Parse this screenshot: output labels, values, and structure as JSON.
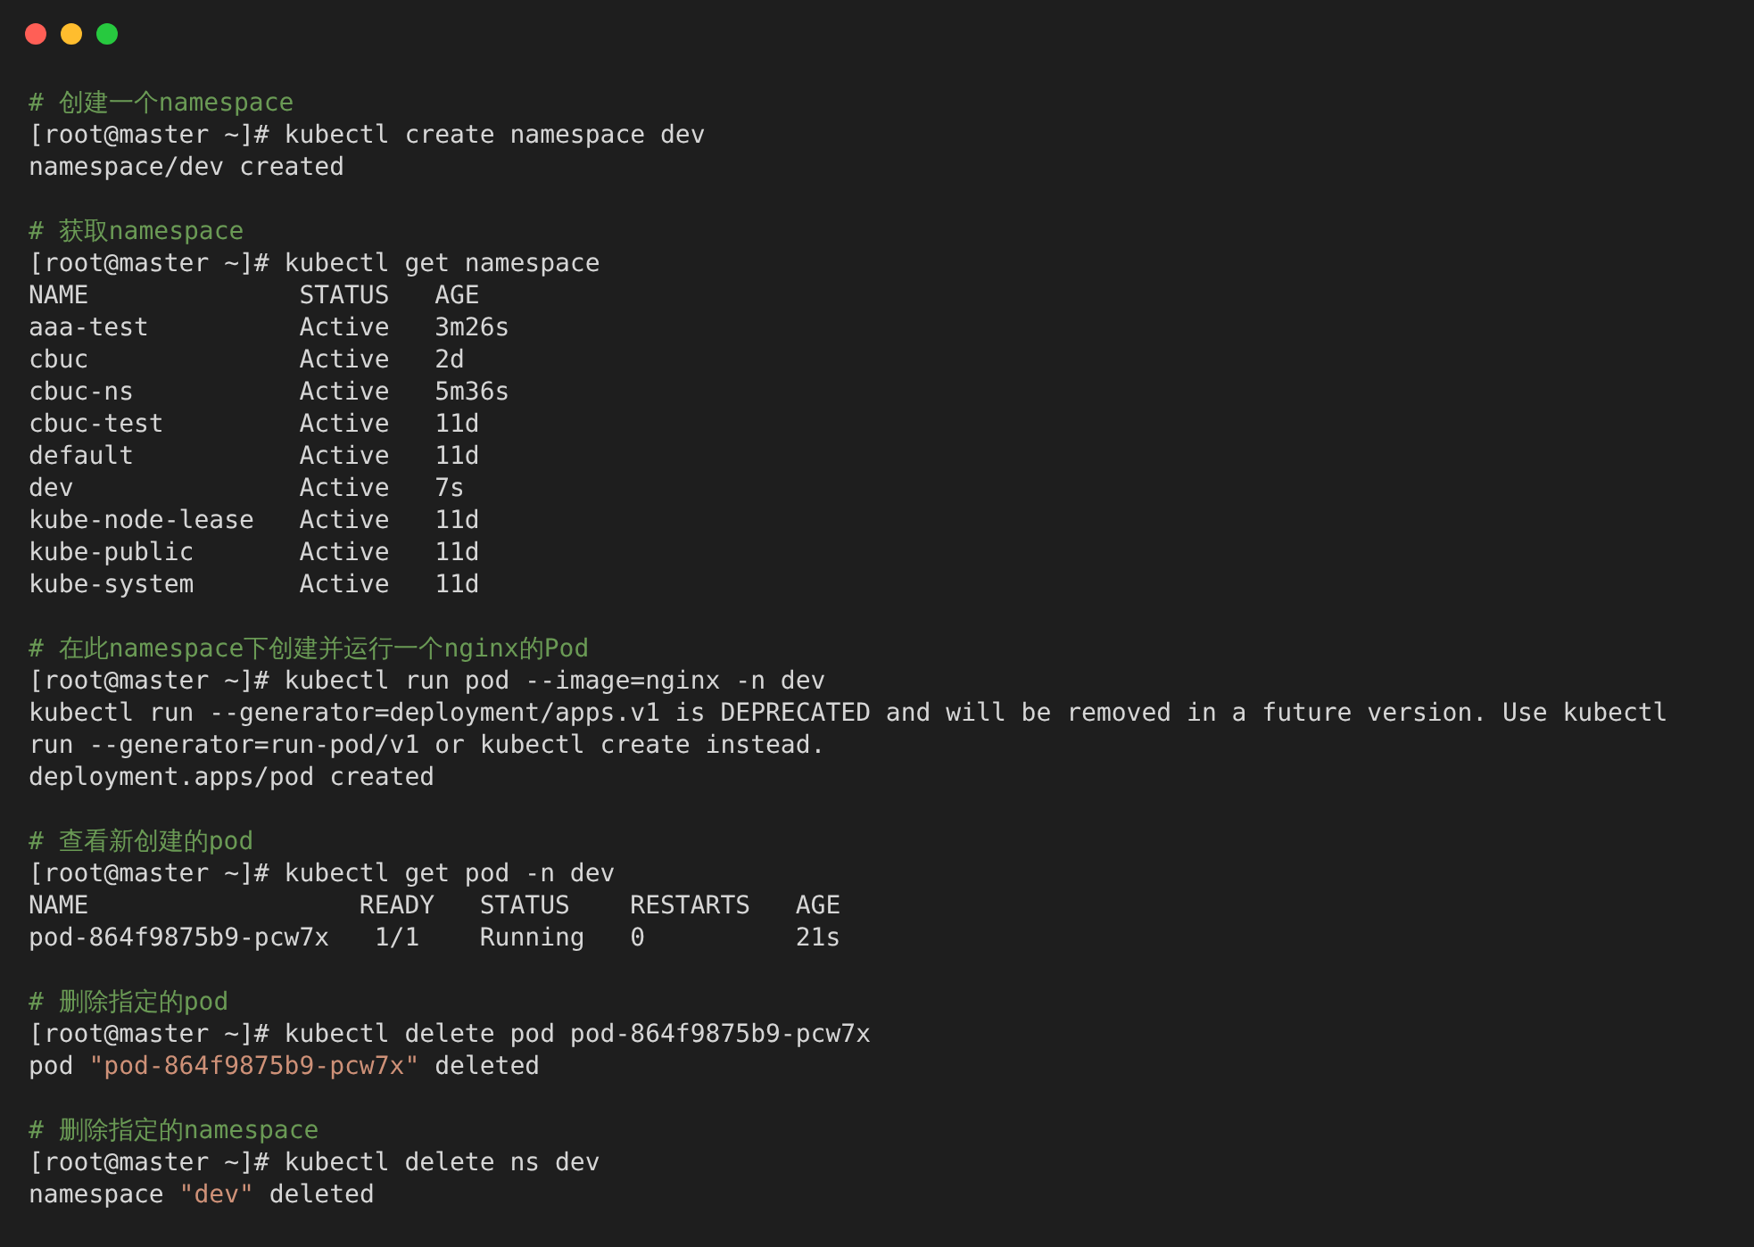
{
  "window": {
    "controls": [
      {
        "color": "#ff5f56"
      },
      {
        "color": "#ffbd2e"
      },
      {
        "color": "#27c93f"
      }
    ]
  },
  "blocks": [
    {
      "lines": [
        {
          "kind": "comment",
          "parts": [
            {
              "kind": "plain",
              "text": "# 创建一个namespace"
            }
          ]
        },
        {
          "kind": "command",
          "parts": [
            {
              "kind": "plain",
              "text": "[root@master ~]# kubectl create namespace dev"
            }
          ]
        },
        {
          "kind": "output",
          "parts": [
            {
              "kind": "plain",
              "text": "namespace/dev created"
            }
          ]
        }
      ]
    },
    {
      "lines": [
        {
          "kind": "comment",
          "parts": [
            {
              "kind": "plain",
              "text": "# 获取namespace"
            }
          ]
        },
        {
          "kind": "command",
          "parts": [
            {
              "kind": "plain",
              "text": "[root@master ~]# kubectl get namespace"
            }
          ]
        },
        {
          "kind": "output",
          "parts": [
            {
              "kind": "plain",
              "text": "NAME              STATUS   AGE"
            }
          ]
        },
        {
          "kind": "output",
          "parts": [
            {
              "kind": "plain",
              "text": "aaa-test          Active   3m26s"
            }
          ]
        },
        {
          "kind": "output",
          "parts": [
            {
              "kind": "plain",
              "text": "cbuc              Active   2d"
            }
          ]
        },
        {
          "kind": "output",
          "parts": [
            {
              "kind": "plain",
              "text": "cbuc-ns           Active   5m36s"
            }
          ]
        },
        {
          "kind": "output",
          "parts": [
            {
              "kind": "plain",
              "text": "cbuc-test         Active   11d"
            }
          ]
        },
        {
          "kind": "output",
          "parts": [
            {
              "kind": "plain",
              "text": "default           Active   11d"
            }
          ]
        },
        {
          "kind": "output",
          "parts": [
            {
              "kind": "plain",
              "text": "dev               Active   7s"
            }
          ]
        },
        {
          "kind": "output",
          "parts": [
            {
              "kind": "plain",
              "text": "kube-node-lease   Active   11d"
            }
          ]
        },
        {
          "kind": "output",
          "parts": [
            {
              "kind": "plain",
              "text": "kube-public       Active   11d"
            }
          ]
        },
        {
          "kind": "output",
          "parts": [
            {
              "kind": "plain",
              "text": "kube-system       Active   11d"
            }
          ]
        }
      ]
    },
    {
      "lines": [
        {
          "kind": "comment",
          "parts": [
            {
              "kind": "plain",
              "text": "# 在此namespace下创建并运行一个nginx的Pod"
            }
          ]
        },
        {
          "kind": "command",
          "parts": [
            {
              "kind": "plain",
              "text": "[root@master ~]# kubectl run pod --image=nginx -n dev"
            }
          ]
        },
        {
          "kind": "output",
          "parts": [
            {
              "kind": "plain",
              "text": "kubectl run --generator=deployment/apps.v1 is DEPRECATED and will be removed in a future version. Use kubectl"
            }
          ]
        },
        {
          "kind": "output",
          "parts": [
            {
              "kind": "plain",
              "text": "run --generator=run-pod/v1 or kubectl create instead."
            }
          ]
        },
        {
          "kind": "output",
          "parts": [
            {
              "kind": "plain",
              "text": "deployment.apps/pod created"
            }
          ]
        }
      ]
    },
    {
      "lines": [
        {
          "kind": "comment",
          "parts": [
            {
              "kind": "plain",
              "text": "# 查看新创建的pod"
            }
          ]
        },
        {
          "kind": "command",
          "parts": [
            {
              "kind": "plain",
              "text": "[root@master ~]# kubectl get pod -n dev"
            }
          ]
        },
        {
          "kind": "output",
          "parts": [
            {
              "kind": "plain",
              "text": "NAME                  READY   STATUS    RESTARTS   AGE"
            }
          ]
        },
        {
          "kind": "output",
          "parts": [
            {
              "kind": "plain",
              "text": "pod-864f9875b9-pcw7x   1/1    Running   0          21s"
            }
          ]
        }
      ]
    },
    {
      "lines": [
        {
          "kind": "comment",
          "parts": [
            {
              "kind": "plain",
              "text": "# 删除指定的pod"
            }
          ]
        },
        {
          "kind": "command",
          "parts": [
            {
              "kind": "plain",
              "text": "[root@master ~]# kubectl delete pod pod-864f9875b9-pcw7x"
            }
          ]
        },
        {
          "kind": "output",
          "parts": [
            {
              "kind": "plain",
              "text": "pod "
            },
            {
              "kind": "string",
              "text": "\"pod-864f9875b9-pcw7x\""
            },
            {
              "kind": "plain",
              "text": " deleted"
            }
          ]
        }
      ]
    },
    {
      "lines": [
        {
          "kind": "comment",
          "parts": [
            {
              "kind": "plain",
              "text": "# 删除指定的namespace"
            }
          ]
        },
        {
          "kind": "command",
          "parts": [
            {
              "kind": "plain",
              "text": "[root@master ~]# kubectl delete ns dev"
            }
          ]
        },
        {
          "kind": "output",
          "parts": [
            {
              "kind": "plain",
              "text": "namespace "
            },
            {
              "kind": "string",
              "text": "\"dev\""
            },
            {
              "kind": "plain",
              "text": " deleted"
            }
          ]
        }
      ]
    }
  ]
}
